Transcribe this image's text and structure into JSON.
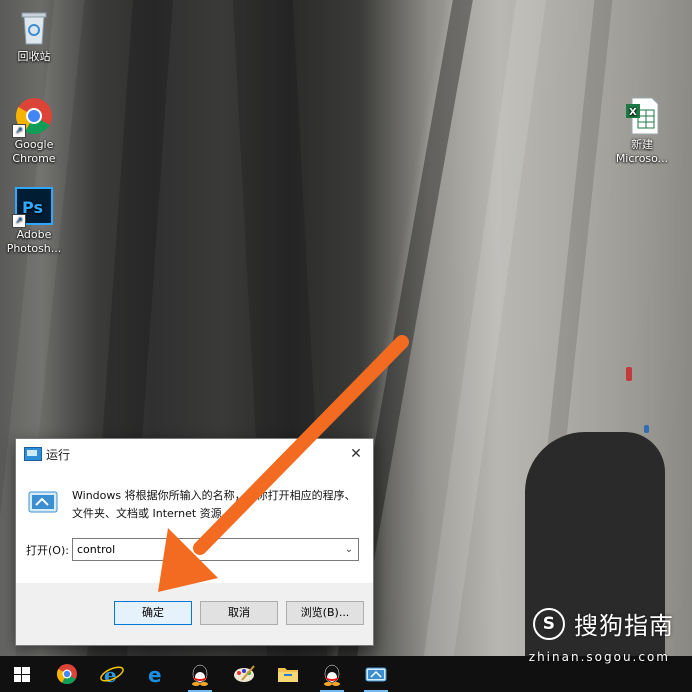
{
  "desktop": {
    "icons": [
      {
        "label": "回收站",
        "icon": "recycle-bin-icon"
      },
      {
        "label": "Google\nChrome",
        "icon": "chrome-icon"
      },
      {
        "label": "Adobe\nPhotosh...",
        "icon": "photoshop-icon"
      },
      {
        "label": "新建\nMicroso...",
        "icon": "excel-file-icon"
      }
    ]
  },
  "run_dialog": {
    "title": "运行",
    "close_glyph": "✕",
    "description": "Windows 将根据你所输入的名称，为你打开相应的程序、文件夹、文档或 Internet 资源。",
    "open_label": "打开(O):",
    "open_value": "control",
    "dropdown_glyph": "⌄",
    "buttons": {
      "ok": "确定",
      "cancel": "取消",
      "browse": "浏览(B)..."
    }
  },
  "watermark": {
    "logo_glyph": "S",
    "text": "搜狗指南",
    "url": "zhinan.sogou.com"
  },
  "taskbar": {
    "items": [
      "windows-start-icon",
      "chrome-icon",
      "internet-explorer-icon",
      "edge-icon",
      "qq-icon",
      "paint-icon",
      "file-explorer-icon",
      "qq-icon",
      "run-app-icon"
    ]
  },
  "colors": {
    "annotation": "#f26b21",
    "accent": "#0078d7",
    "taskbar": "#101010"
  }
}
